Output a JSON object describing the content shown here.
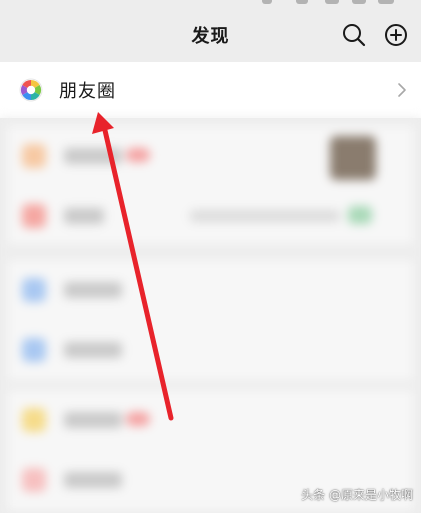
{
  "header": {
    "title": "发现",
    "search_icon": "search-icon",
    "add_icon": "plus-circle-icon"
  },
  "moments": {
    "label": "朋友圈",
    "icon": "moments-camera-shutter-icon",
    "chevron_icon": "chevron-right-icon"
  },
  "annotation": {
    "arrow_color": "#e8232b"
  },
  "watermark": {
    "text": "头条 @原来是小牧啊"
  }
}
